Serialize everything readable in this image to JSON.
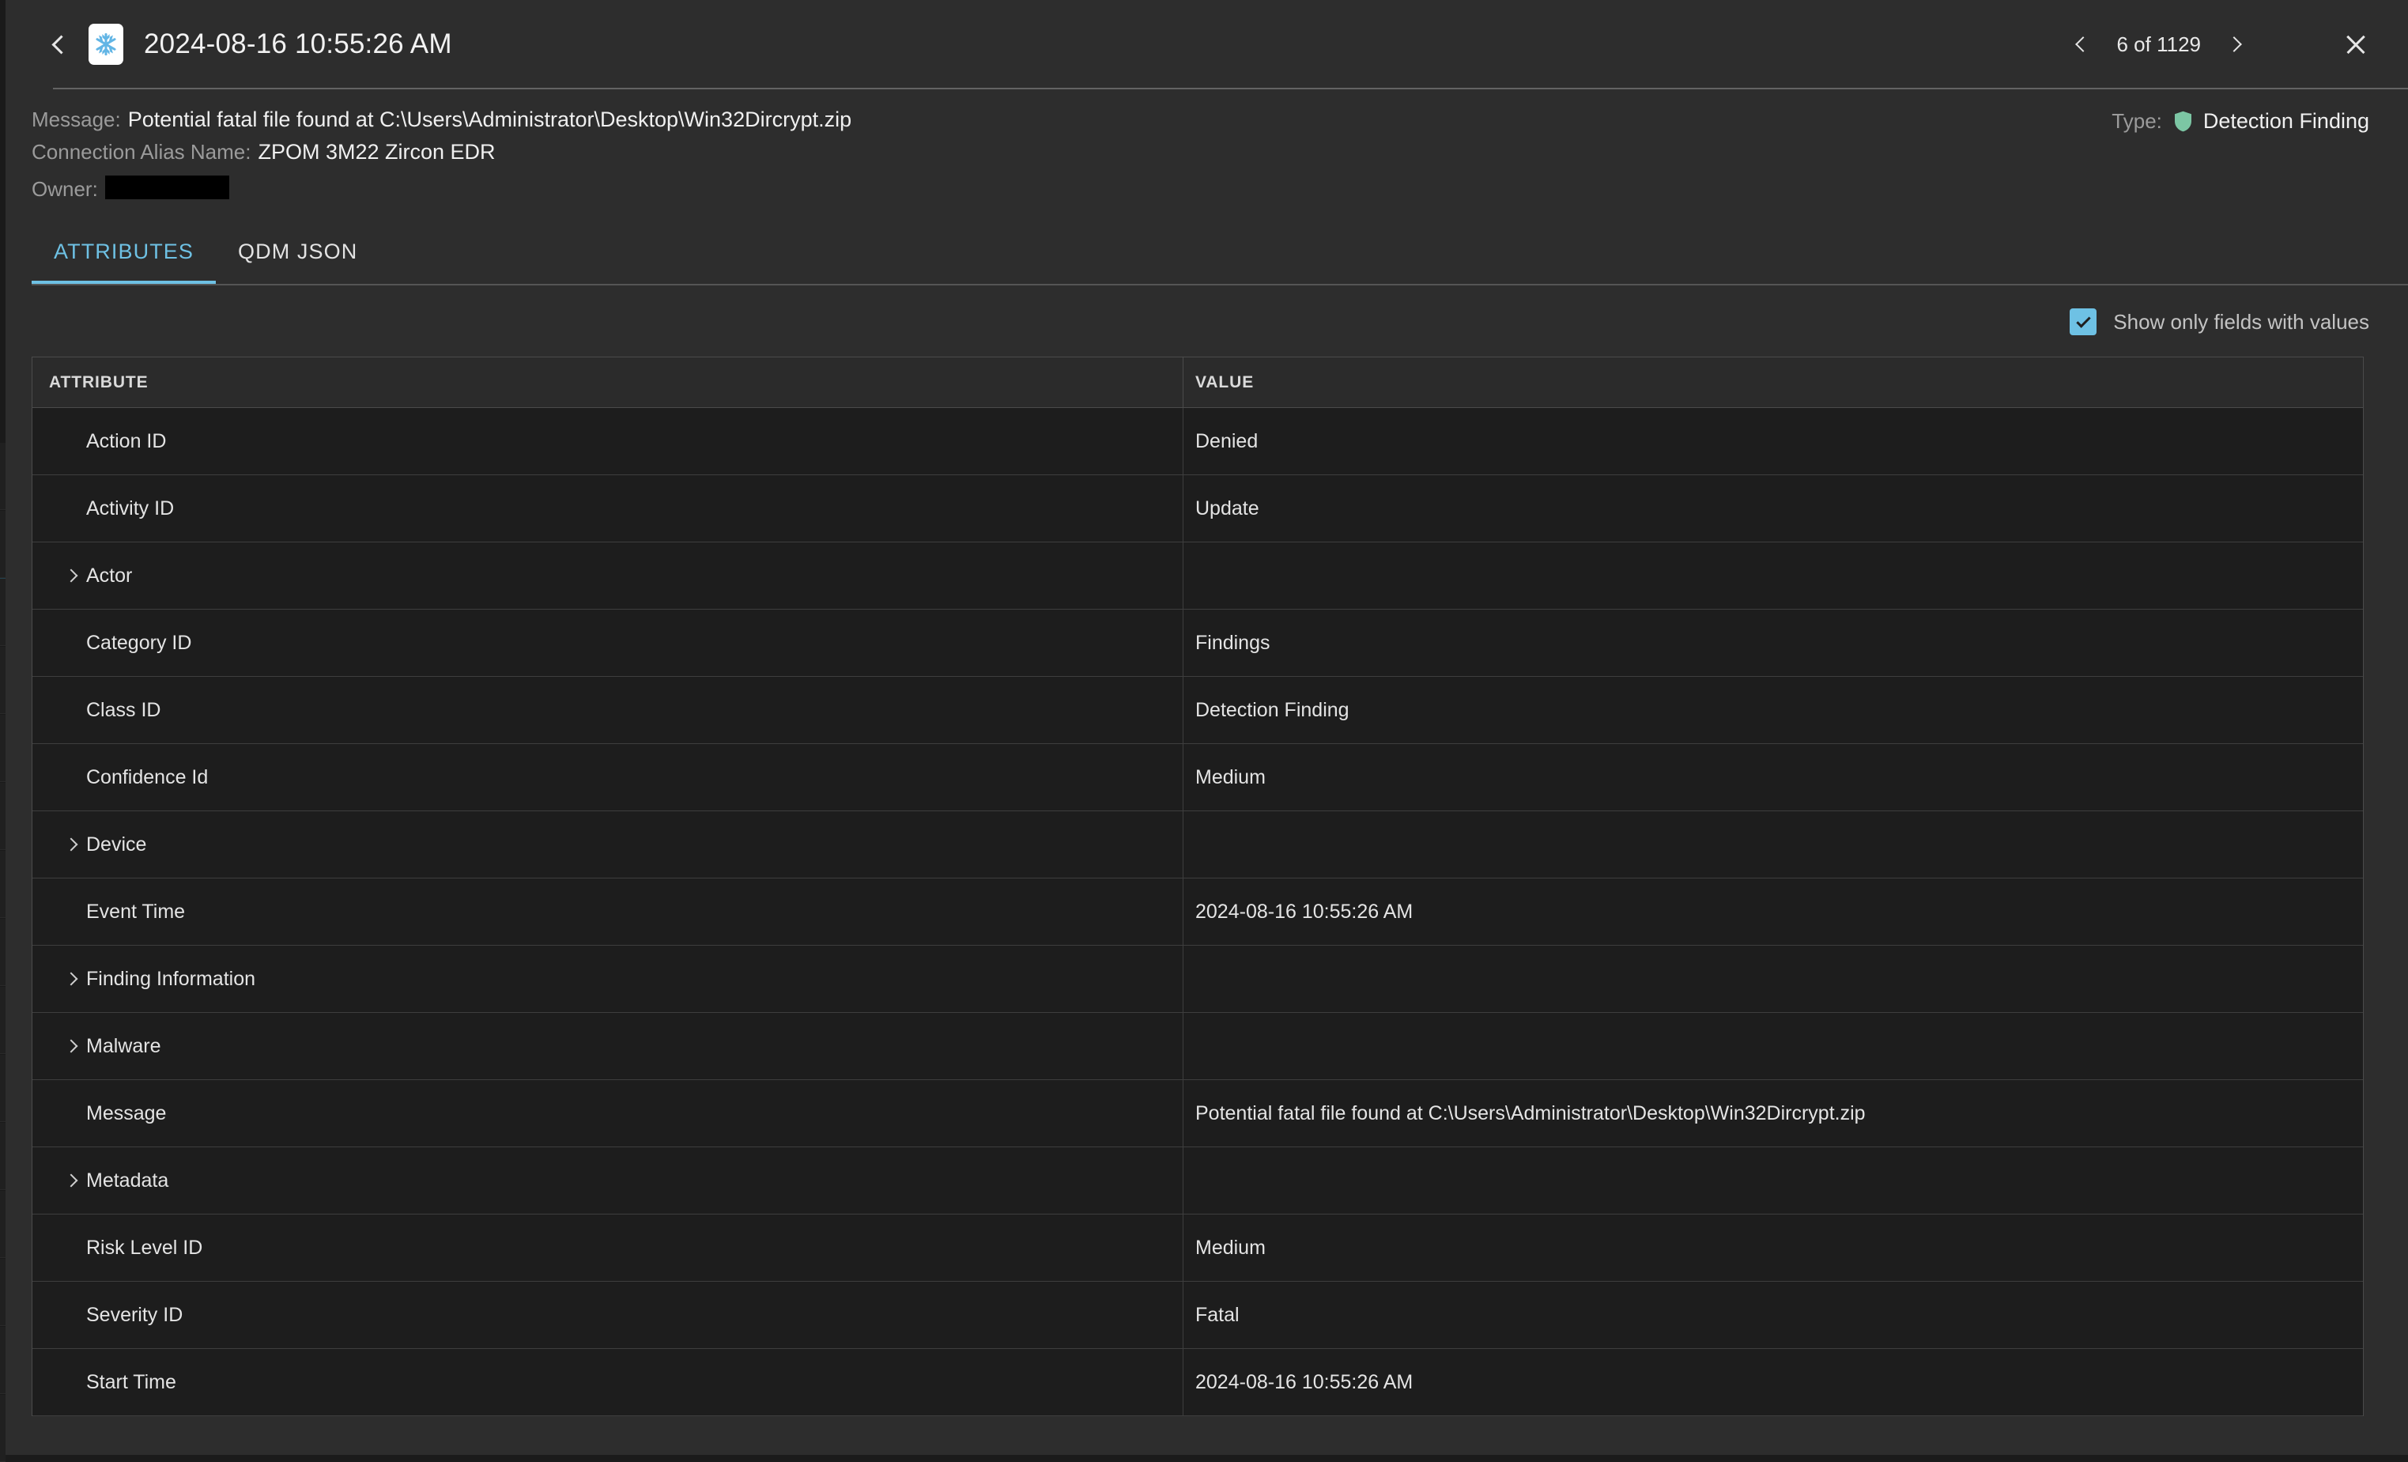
{
  "titlebar": {
    "back_icon": "chevron-left-icon",
    "logo_icon": "snowflake-logo-icon",
    "title": "2024-08-16 10:55:26 AM",
    "prev_icon": "chevron-left-icon",
    "next_icon": "chevron-right-icon",
    "pager_label": "6 of 1129",
    "close_icon": "close-icon"
  },
  "summary": {
    "message_key": "Message:",
    "message_value": "Potential fatal file found at C:\\Users\\Administrator\\Desktop\\Win32Dircrypt.zip",
    "connection_alias_key": "Connection Alias Name:",
    "connection_alias_value": "ZPOM 3M22 Zircon EDR",
    "owner_key": "Owner:",
    "owner_value": "",
    "type_key": "Type:",
    "type_icon": "shield-icon",
    "type_value": "Detection Finding",
    "type_color": "#7cc6a4"
  },
  "tabs": [
    {
      "label": "ATTRIBUTES",
      "active": true
    },
    {
      "label": "QDM JSON",
      "active": false
    }
  ],
  "filter": {
    "checkbox_icon": "checkbox-checked-icon",
    "checked": true,
    "label": "Show only fields with values",
    "accent_color": "#6ec1e4"
  },
  "table": {
    "columns": [
      "ATTRIBUTE",
      "VALUE"
    ],
    "rows": [
      {
        "attribute": "Action ID",
        "value": "Denied",
        "expandable": false
      },
      {
        "attribute": "Activity ID",
        "value": "Update",
        "expandable": false
      },
      {
        "attribute": "Actor",
        "value": "",
        "expandable": true
      },
      {
        "attribute": "Category ID",
        "value": "Findings",
        "expandable": false
      },
      {
        "attribute": "Class ID",
        "value": "Detection Finding",
        "expandable": false
      },
      {
        "attribute": "Confidence Id",
        "value": "Medium",
        "expandable": false
      },
      {
        "attribute": "Device",
        "value": "",
        "expandable": true
      },
      {
        "attribute": "Event Time",
        "value": "2024-08-16 10:55:26 AM",
        "expandable": false
      },
      {
        "attribute": "Finding Information",
        "value": "",
        "expandable": true
      },
      {
        "attribute": "Malware",
        "value": "",
        "expandable": true
      },
      {
        "attribute": "Message",
        "value": "Potential fatal file found at C:\\Users\\Administrator\\Desktop\\Win32Dircrypt.zip",
        "expandable": false
      },
      {
        "attribute": "Metadata",
        "value": "",
        "expandable": true
      },
      {
        "attribute": "Risk Level ID",
        "value": "Medium",
        "expandable": false
      },
      {
        "attribute": "Severity ID",
        "value": "Fatal",
        "expandable": false
      },
      {
        "attribute": "Start Time",
        "value": "2024-08-16 10:55:26 AM",
        "expandable": false
      }
    ]
  }
}
